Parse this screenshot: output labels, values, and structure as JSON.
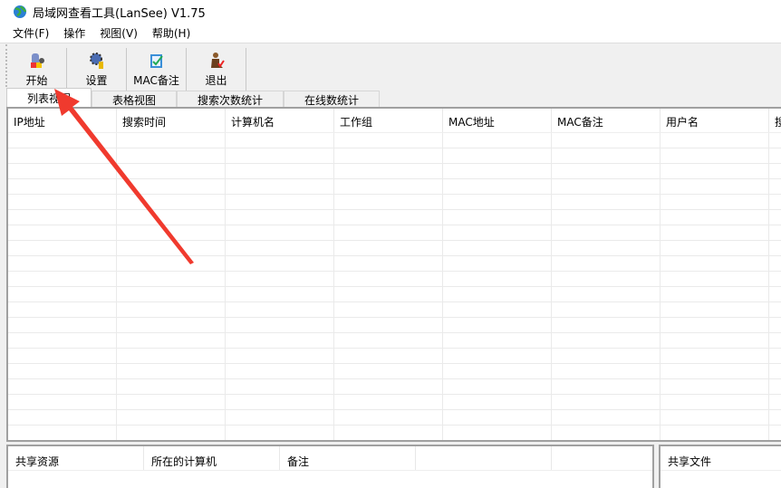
{
  "window": {
    "title": "局域网查看工具(LanSee) V1.75",
    "icon": "globe-icon"
  },
  "menu": [
    "文件(F)",
    "操作",
    "视图(V)",
    "帮助(H)"
  ],
  "toolbar": [
    {
      "label": "开始",
      "icon": "start-icon"
    },
    {
      "label": "设置",
      "icon": "settings-gear-icon"
    },
    {
      "label": "MAC备注",
      "icon": "mac-note-icon"
    },
    {
      "label": "退出",
      "icon": "exit-icon"
    }
  ],
  "tabs": [
    "列表视图",
    "表格视图",
    "搜索次数统计",
    "在线数统计"
  ],
  "list": {
    "columns": [
      "IP地址",
      "搜索时间",
      "计算机名",
      "工作组",
      "MAC地址",
      "MAC备注",
      "用户名",
      "搜"
    ]
  },
  "shares": {
    "columns": [
      "共享资源",
      "所在的计算机",
      "备注",
      ""
    ]
  },
  "files": {
    "columns": [
      "共享文件"
    ]
  },
  "annotation": {
    "color": "#f03a2e"
  }
}
